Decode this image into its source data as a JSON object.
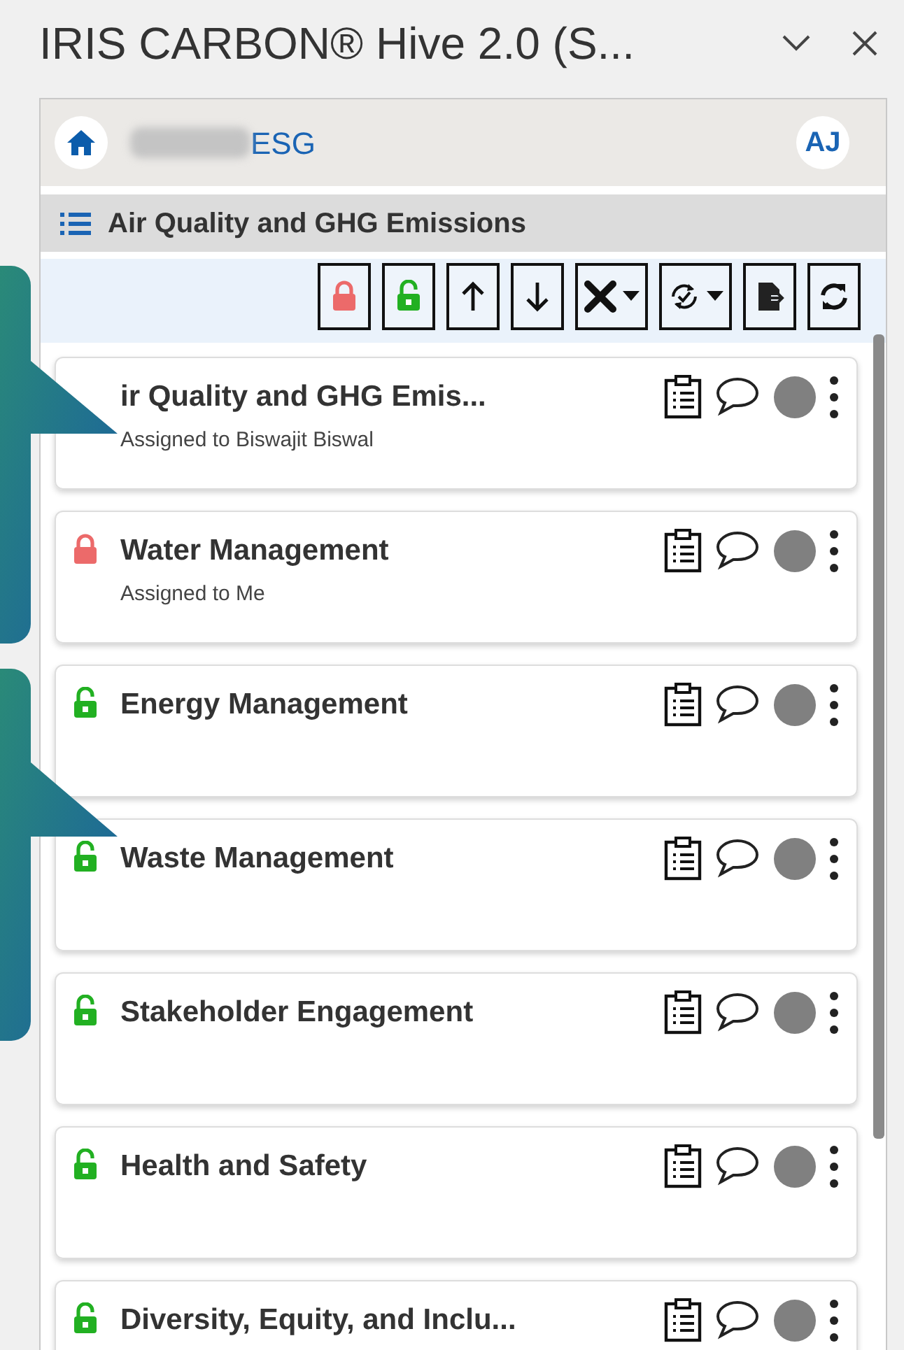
{
  "window": {
    "title": "IRIS CARBON® Hive 2.0 (S..."
  },
  "header": {
    "app_name": "ESG",
    "avatar": "AJ"
  },
  "section": {
    "title": "Air Quality and GHG Emissions"
  },
  "toolbar": [
    {
      "kind": "lock",
      "dropdown": false
    },
    {
      "kind": "unlock",
      "dropdown": false
    },
    {
      "kind": "up",
      "dropdown": false
    },
    {
      "kind": "down",
      "dropdown": false
    },
    {
      "kind": "tools",
      "dropdown": true
    },
    {
      "kind": "sync",
      "dropdown": true
    },
    {
      "kind": "export",
      "dropdown": false
    },
    {
      "kind": "refresh",
      "dropdown": false
    }
  ],
  "items": [
    {
      "title": "ir Quality and GHG Emis...",
      "subtitle": "Assigned to Biswajit Biswal",
      "color": "#808080"
    },
    {
      "title": "Water Management",
      "subtitle": "Assigned to Me",
      "locked": true,
      "color": "#808080"
    },
    {
      "title": "Energy Management",
      "locked": false,
      "color": "#808080"
    },
    {
      "title": "Waste Management",
      "locked": false,
      "color": "#808080"
    },
    {
      "title": "Stakeholder Engagement",
      "locked": false,
      "color": "#808080"
    },
    {
      "title": "Health and Safety",
      "locked": false,
      "color": "#808080"
    },
    {
      "title": "Diversity, Equity, and Inclu...",
      "locked": false,
      "color": "#808080"
    }
  ],
  "callouts": [
    {
      "kind": "arrow"
    },
    {
      "kind": "arrow"
    }
  ]
}
